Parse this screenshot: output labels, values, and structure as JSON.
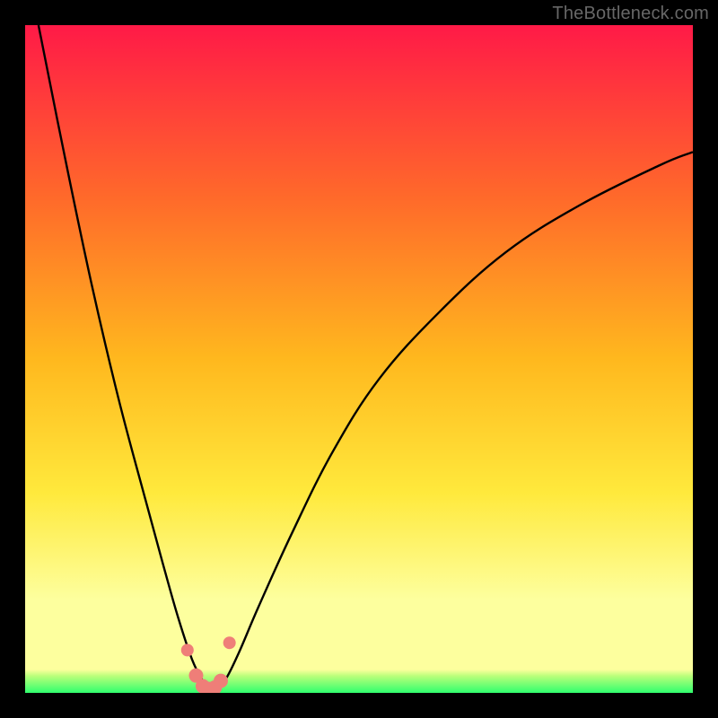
{
  "watermark": "TheBottleneck.com",
  "colors": {
    "bg_black": "#000000",
    "grad_top": "#ff1a47",
    "grad_mid1": "#ff6a2a",
    "grad_mid2": "#ffb81e",
    "grad_mid3": "#ffe93c",
    "grad_mid4": "#fdff9e",
    "grad_green": "#2fff6e",
    "curve": "#000000",
    "marker_fill": "#ef7e78",
    "marker_stroke": "#a83e3a"
  },
  "chart_data": {
    "type": "line",
    "title": "",
    "xlabel": "",
    "ylabel": "",
    "xlim": [
      0,
      100
    ],
    "ylim": [
      0,
      100
    ],
    "series": [
      {
        "name": "bottleneck-curve",
        "x": [
          2,
          6,
          10,
          14,
          18,
          21,
          23,
          25,
          26.5,
          27.5,
          28.5,
          30,
          32,
          35,
          40,
          46,
          53,
          62,
          72,
          83,
          95,
          100
        ],
        "y": [
          100,
          80,
          61,
          44,
          29,
          18,
          11,
          5,
          2,
          0.8,
          0.8,
          2,
          6,
          13,
          24,
          36,
          47,
          57,
          66,
          73,
          79,
          81
        ]
      }
    ],
    "markers": {
      "name": "highlight-cluster",
      "x": [
        24.3,
        25.6,
        26.6,
        27.4,
        28.4,
        29.3,
        30.6
      ],
      "y": [
        6.4,
        2.6,
        1.0,
        0.6,
        0.8,
        1.8,
        7.5
      ]
    }
  }
}
